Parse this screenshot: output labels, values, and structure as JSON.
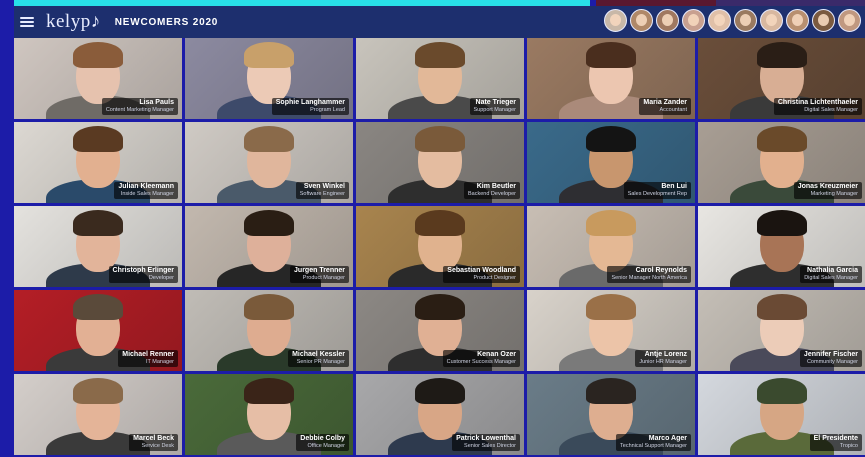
{
  "app": {
    "logo": "kelyp♪",
    "room_title": "NEWCOMERS 2020"
  },
  "header": {
    "avatars": [
      {
        "bg": "#c8b8a8"
      },
      {
        "bg": "#b08868"
      },
      {
        "bg": "#a07860"
      },
      {
        "bg": "#c8a090"
      },
      {
        "bg": "#e0c0a8"
      },
      {
        "bg": "#9a7a60"
      },
      {
        "bg": "#d8b8a0"
      },
      {
        "bg": "#b89070"
      },
      {
        "bg": "#7a5a40"
      },
      {
        "bg": "#c09880"
      }
    ]
  },
  "participants": [
    {
      "name": "Lisa Pauls",
      "role": "Content Marketing Manager",
      "bg": "#cfc6c0",
      "skin": "#e6c2ae",
      "hair": "#8a5c3a",
      "shirt": "#6f6b66"
    },
    {
      "name": "Sophie Langhammer",
      "role": "Program Lead",
      "bg": "#8c8aa0",
      "skin": "#eccab6",
      "hair": "#c8a06a",
      "shirt": "#3d4a6a"
    },
    {
      "name": "Nate Trieger",
      "role": "Support Manager",
      "bg": "#c8c4bc",
      "skin": "#e2b898",
      "hair": "#6a4a2c",
      "shirt": "#4a4a4a"
    },
    {
      "name": "Maria Zander",
      "role": "Accountant",
      "bg": "#9a7a62",
      "skin": "#ecc6b0",
      "hair": "#4a2e1e",
      "shirt": "#aa8a7a"
    },
    {
      "name": "Christina Lichtenthaeler",
      "role": "Digital Sales Manager",
      "bg": "#6a4e3a",
      "skin": "#d8ae94",
      "hair": "#2a1e16",
      "shirt": "#3a3a3a"
    },
    {
      "name": "Julian Kleemann",
      "role": "Inside Sales Manager",
      "bg": "#dcd8d2",
      "skin": "#e2b090",
      "hair": "#5a3a22",
      "shirt": "#2a4a6a"
    },
    {
      "name": "Sven Winkel",
      "role": "Software Engineer",
      "bg": "#cfcac4",
      "skin": "#e0b69c",
      "hair": "#8a6a4a",
      "shirt": "#4a5a6a"
    },
    {
      "name": "Kim Beutler",
      "role": "Backend Developer",
      "bg": "#8a8682",
      "skin": "#e4bca0",
      "hair": "#7a5a3a",
      "shirt": "#2e2e2e"
    },
    {
      "name": "Ben Lui",
      "role": "Sales Development Rep",
      "bg": "#3a6a8a",
      "skin": "#c8966e",
      "hair": "#141414",
      "shirt": "#2e2e32"
    },
    {
      "name": "Jonas Kreuzmeier",
      "role": "Marketing Manager",
      "bg": "#a89e94",
      "skin": "#e2b08e",
      "hair": "#6a4a2a",
      "shirt": "#3a4a3a"
    },
    {
      "name": "Christoph Erlinger",
      "role": "Developer",
      "bg": "#e4e2de",
      "skin": "#e2b49a",
      "hair": "#3a2a1e",
      "shirt": "#2e3a4a"
    },
    {
      "name": "Jurgen Trenner",
      "role": "Product Manager",
      "bg": "#c2b8ae",
      "skin": "#deb09a",
      "hair": "#2a1e14",
      "shirt": "#262626"
    },
    {
      "name": "Sebastian Woodland",
      "role": "Product Designer",
      "bg": "#a8844e",
      "skin": "#e0b28e",
      "hair": "#5a3a1e",
      "shirt": "#2a2a2a"
    },
    {
      "name": "Carol Reynolds",
      "role": "Senior Manager North America",
      "bg": "#c8beb4",
      "skin": "#e4b894",
      "hair": "#c89a5e",
      "shirt": "#6a6a6a"
    },
    {
      "name": "Nathalia Garcia",
      "role": "Digital Sales Manager",
      "bg": "#e8e6e2",
      "skin": "#a87456",
      "hair": "#1a1410",
      "shirt": "#2e2e2e"
    },
    {
      "name": "Michael Renner",
      "role": "IT Manager",
      "bg": "#b41e26",
      "skin": "#e2b094",
      "hair": "#5a4a3a",
      "shirt": "#3a3a3a"
    },
    {
      "name": "Michael Kessler",
      "role": "Senior PR Manager",
      "bg": "#c0bcb6",
      "skin": "#deac90",
      "hair": "#7a5a3a",
      "shirt": "#2a3a2a"
    },
    {
      "name": "Kenan Ozer",
      "role": "Customer Success Manager",
      "bg": "#8c8884",
      "skin": "#e0b094",
      "hair": "#2a1e14",
      "shirt": "#2e2e2e"
    },
    {
      "name": "Antje Lorenz",
      "role": "Junior HR Manager",
      "bg": "#d8d2ca",
      "skin": "#ecc4a8",
      "hair": "#9a7048",
      "shirt": "#7a7a7a"
    },
    {
      "name": "Jennifer Fischer",
      "role": "Community Manager",
      "bg": "#c4beb6",
      "skin": "#ecccb8",
      "hair": "#6a4a34",
      "shirt": "#4a4a5a"
    },
    {
      "name": "Marcel Beck",
      "role": "Service Desk",
      "bg": "#d4ceca",
      "skin": "#e4b498",
      "hair": "#8a6a4a",
      "shirt": "#3a3a3a"
    },
    {
      "name": "Debbie Colby",
      "role": "Office Manager",
      "bg": "#4a6a3a",
      "skin": "#e6bea6",
      "hair": "#3a2418",
      "shirt": "#5a5a5a"
    },
    {
      "name": "Patrick Lowenthal",
      "role": "Senior Sales Director",
      "bg": "#a8a8aa",
      "skin": "#d8a686",
      "hair": "#1e1a16",
      "shirt": "#2e3a4e"
    },
    {
      "name": "Marco Ager",
      "role": "Technical Support Manager",
      "bg": "#6a7c88",
      "skin": "#deae90",
      "hair": "#2a2420",
      "shirt": "#3a4a5a"
    },
    {
      "name": "El Presidente",
      "role": "Tropico",
      "bg": "#d4d8de",
      "skin": "#d6a684",
      "hair": "#3a4a2e",
      "shirt": "#5a6a3a"
    }
  ]
}
